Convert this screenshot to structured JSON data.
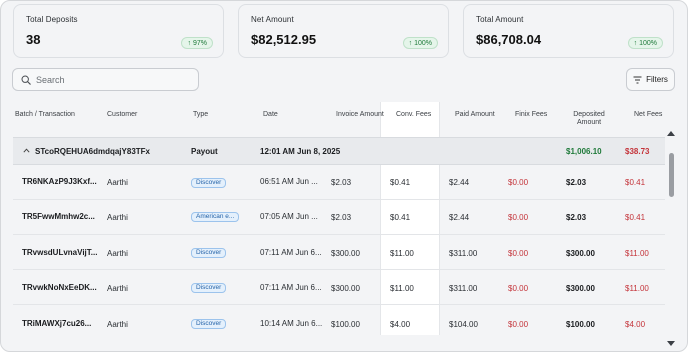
{
  "stats": [
    {
      "label": "Total Deposits",
      "value": "38",
      "badge": "97%"
    },
    {
      "label": "Net Amount",
      "value": "$82,512.95",
      "badge": "100%"
    },
    {
      "label": "Total Amount",
      "value": "$86,708.04",
      "badge": "100%"
    }
  ],
  "search": {
    "placeholder": "Search",
    "value": ""
  },
  "filters_label": "Filters",
  "columns": {
    "batch": "Batch / Transaction",
    "customer": "Customer",
    "type": "Type",
    "date": "Date",
    "invoice": "Invoice Amount",
    "conv": "Conv. Fees",
    "paid": "Paid Amount",
    "finix": "Finix Fees",
    "deposited_1": "Deposited",
    "deposited_2": "Amount",
    "net": "Net Fees"
  },
  "group": {
    "batch_id": "STcoRQEHUA6dmdqajY83TFx",
    "type": "Payout",
    "date": "12:01 AM Jun 8, 2025",
    "deposited": "$1,006.10",
    "net_fees": "$38.73"
  },
  "rows": [
    {
      "id": "TR6NKAzP9J3Kxf...",
      "customer": "Aarthi",
      "type": "Discover",
      "date": "06:51 AM Jun ...",
      "invoice": "$2.03",
      "conv": "$0.41",
      "paid": "$2.44",
      "finix": "$0.00",
      "deposited": "$2.03",
      "net": "$0.41"
    },
    {
      "id": "TR5FwwMmhw2c...",
      "customer": "Aarthi",
      "type": "American e...",
      "date": "07:05 AM Jun ...",
      "invoice": "$2.03",
      "conv": "$0.41",
      "paid": "$2.44",
      "finix": "$0.00",
      "deposited": "$2.03",
      "net": "$0.41"
    },
    {
      "id": "TRvwsdULvnaVijT...",
      "customer": "Aarthi",
      "type": "Discover",
      "date": "07:11 AM Jun 6...",
      "invoice": "$300.00",
      "conv": "$11.00",
      "paid": "$311.00",
      "finix": "$0.00",
      "deposited": "$300.00",
      "net": "$11.00"
    },
    {
      "id": "TRvwkNoNxEeDK...",
      "customer": "Aarthi",
      "type": "Discover",
      "date": "07:11 AM Jun 6...",
      "invoice": "$300.00",
      "conv": "$11.00",
      "paid": "$311.00",
      "finix": "$0.00",
      "deposited": "$300.00",
      "net": "$11.00"
    },
    {
      "id": "TRiMAWXj7cu26...",
      "customer": "Aarthi",
      "type": "Discover",
      "date": "10:14 AM Jun 6...",
      "invoice": "$100.00",
      "conv": "$4.00",
      "paid": "$104.00",
      "finix": "$0.00",
      "deposited": "$100.00",
      "net": "$4.00"
    }
  ],
  "colors": {
    "accent_red": "#c4343a",
    "accent_green": "#1f7a3a",
    "badge_blue": "#2563a8"
  },
  "icons": {
    "search": "search-icon",
    "filters": "filter-lines-icon",
    "collapse": "chevron-up-icon",
    "badge": "arrow-up-icon"
  }
}
